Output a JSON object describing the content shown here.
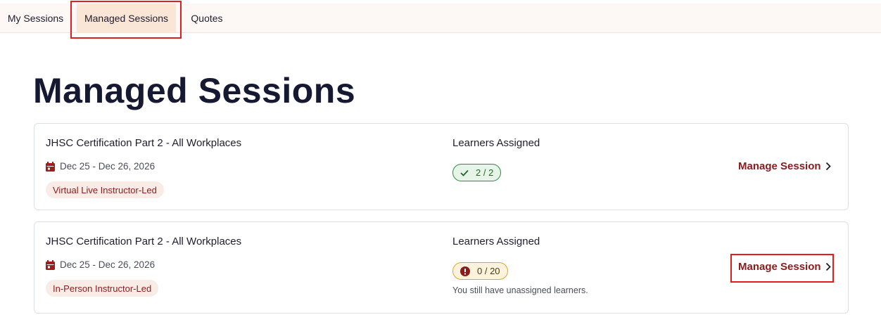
{
  "tabs": [
    {
      "label": "My Sessions",
      "active": false
    },
    {
      "label": "Managed Sessions",
      "active": true
    },
    {
      "label": "Quotes",
      "active": false
    }
  ],
  "page_title": "Managed Sessions",
  "colors": {
    "accent": "#8a1c1c",
    "success": "#2e8b3d",
    "warning": "#e3a42a",
    "highlight": "#e01e1e"
  },
  "sessions": [
    {
      "course": "JHSC Certification Part 2 - All Workplaces",
      "date": "Dec 25 - Dec 26, 2026",
      "date_icon": "calendar-icon",
      "delivery": "Virtual Live Instructor-Led",
      "learners_label": "Learners Assigned",
      "learners_status": "complete",
      "learners_icon": "checkmark-icon",
      "learners_count": "2 / 2",
      "action": "Manage Session",
      "action_icon": "chevron-right-icon"
    },
    {
      "course": "JHSC Certification Part 2 - All Workplaces",
      "date": "Dec 25 - Dec 26, 2026",
      "date_icon": "calendar-icon",
      "delivery": "In-Person Instructor-Led",
      "learners_label": "Learners Assigned",
      "learners_status": "warning",
      "learners_icon": "alert-icon",
      "learners_count": "0 / 20",
      "learners_note": "You still have unassigned learners.",
      "action": "Manage Session",
      "action_icon": "chevron-right-icon"
    }
  ]
}
